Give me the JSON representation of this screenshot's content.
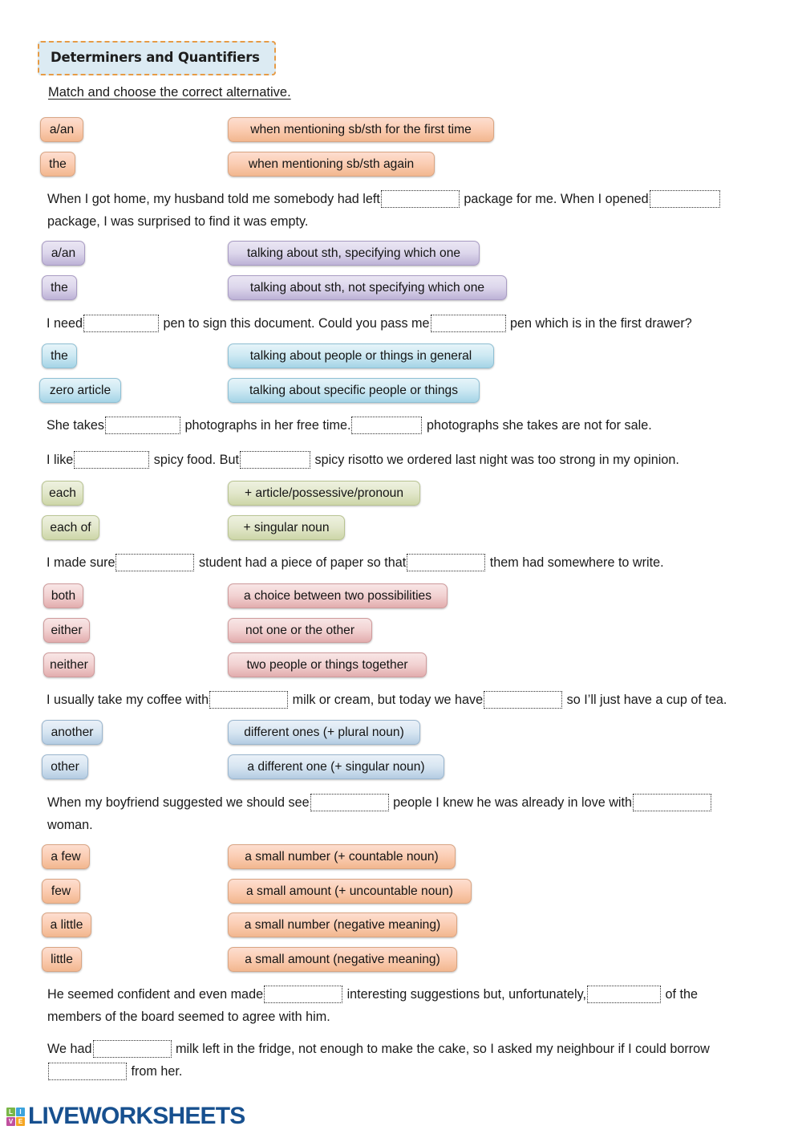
{
  "header": {
    "title": "Determiners and Quantifiers",
    "instruction": "Match and choose the correct alternative."
  },
  "sections": [
    {
      "theme": "peach",
      "terms": [
        "a/an",
        "the"
      ],
      "definitions": [
        "when mentioning sb/sth for the first time",
        "when mentioning sb/sth again"
      ],
      "sentences": [
        "When I got home, my husband told me somebody had left [BLANK] package for me. When I opened [BLANK] package, I was surprised to find it was empty."
      ]
    },
    {
      "theme": "purple",
      "terms": [
        "a/an",
        "the"
      ],
      "definitions": [
        "talking about sth, specifying which one",
        "talking about sth, not specifying which one"
      ],
      "sentences": [
        "I need [BLANK] pen to sign this document. Could you pass me [BLANK] pen which is in the first drawer?"
      ]
    },
    {
      "theme": "cyan",
      "terms": [
        "the",
        "zero article"
      ],
      "definitions": [
        "talking about people or things in general",
        "talking about specific people or things"
      ],
      "sentences": [
        "She takes [BLANK] photographs in her free time. [BLANK] photographs she takes are not for sale.",
        "I like [BLANK] spicy food. But [BLANK] spicy risotto we ordered last night was too strong in my opinion."
      ]
    },
    {
      "theme": "green",
      "terms": [
        "each",
        "each of"
      ],
      "definitions": [
        "+ article/possessive/pronoun",
        "+ singular noun"
      ],
      "sentences": [
        "I made sure [BLANK] student had a piece of paper so that [BLANK] them had somewhere to write."
      ]
    },
    {
      "theme": "pink",
      "terms": [
        "both",
        "either",
        "neither"
      ],
      "definitions": [
        "a choice between two possibilities",
        "not one or the other",
        "two people or things together"
      ],
      "sentences": [
        "I usually take my coffee with [BLANK] milk or cream, but today we have [BLANK] so I’ll just have a cup of tea."
      ]
    },
    {
      "theme": "steel",
      "terms": [
        "another",
        "other"
      ],
      "definitions": [
        "different ones (+ plural noun)",
        "a different one (+ singular noun)"
      ],
      "sentences": [
        "When my boyfriend suggested we should see [BLANK] people I knew he was already in love with [BLANK] woman."
      ]
    },
    {
      "theme": "peach",
      "terms": [
        "a few",
        "few",
        "a little",
        "little"
      ],
      "definitions": [
        "a small number (+ countable noun)",
        "a small amount (+ uncountable noun)",
        "a small number (negative meaning)",
        "a small amount (negative meaning)"
      ],
      "sentences": [
        "He seemed confident and even made [BLANK] interesting suggestions but, unfortunately, [BLANK] of the members of the board seemed to agree with him.",
        "We had [BLANK] milk left in the fridge, not enough to make the cake, so I asked my neighbour if I could borrow [BLANK] from her."
      ]
    }
  ],
  "footer": {
    "logo_cells": [
      "LI",
      "VE"
    ],
    "logo_letters": [
      "L",
      "I",
      "V",
      "E"
    ],
    "brand": "LIVEWORKSHEETS"
  },
  "colors": {
    "title_bg": "#dcebf3",
    "title_border": "#e69b46",
    "brand_blue": "#17508f",
    "peach": "#fbcdb3",
    "purple": "#ddd7ec",
    "cyan": "#cde9f3",
    "green": "#e2e7cb",
    "pink": "#f2d2d2",
    "steel": "#d8e6f2"
  }
}
